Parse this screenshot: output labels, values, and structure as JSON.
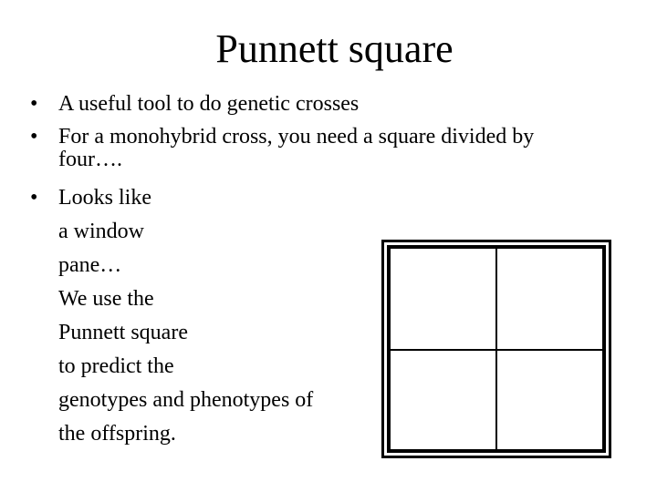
{
  "slide": {
    "title": "Punnett square",
    "bullets": [
      {
        "marker": "•",
        "lines": [
          "A useful tool to do genetic crosses"
        ]
      },
      {
        "marker": "•",
        "lines": [
          "For a monohybrid cross, you need a square divided by",
          "four…."
        ]
      },
      {
        "marker": "•",
        "lines": [
          "Looks like",
          "a window",
          "pane…",
          "We use the",
          "Punnett square",
          "to predict the",
          "genotypes and phenotypes of",
          "the offspring."
        ]
      }
    ],
    "diagram": {
      "name": "Punnett square grid",
      "rows": 2,
      "cols": 2,
      "cells": [
        "",
        "",
        "",
        ""
      ],
      "stroke_color": "#000000",
      "fill_color": "#ffffff"
    }
  }
}
